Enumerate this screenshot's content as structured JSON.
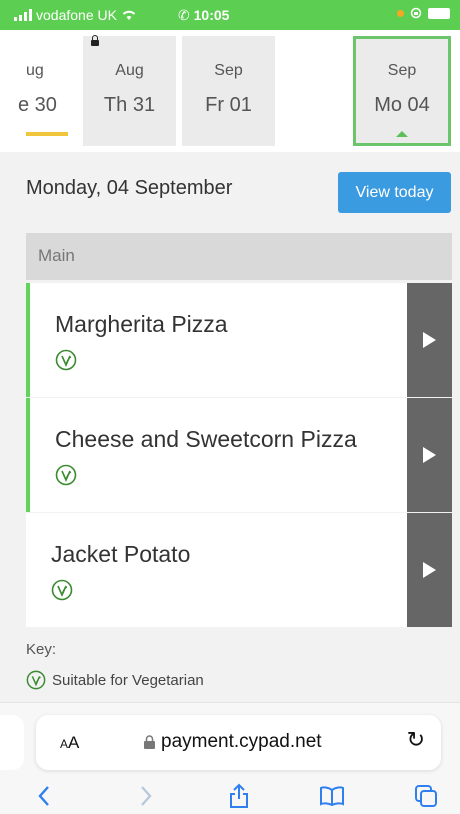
{
  "status_bar": {
    "carrier": "vodafone UK",
    "time": "10:05"
  },
  "date_strip": {
    "days": [
      {
        "month": "ug",
        "day": "e 30",
        "is_today": true
      },
      {
        "month": "Aug",
        "day": "Th 31",
        "locked": true
      },
      {
        "month": "Sep",
        "day": "Fr 01"
      },
      {
        "month": "Sep",
        "day": "Mo 04",
        "selected": true
      }
    ]
  },
  "page": {
    "date_heading": "Monday, 04 September",
    "view_today_label": "View today",
    "section_title": "Main"
  },
  "menu_items": [
    {
      "name": "Margherita Pizza",
      "vegetarian": true
    },
    {
      "name": "Cheese and Sweetcorn Pizza",
      "vegetarian": true
    },
    {
      "name": "Jacket Potato",
      "vegetarian": true
    }
  ],
  "key": {
    "label": "Key:",
    "vegetarian_label": "Suitable for Vegetarian"
  },
  "browser": {
    "text_size_label_small": "A",
    "text_size_label_large": "A",
    "url": "payment.cypad.net"
  },
  "colors": {
    "status_bar": "#5ccf52",
    "accent_blue": "#3b9be0",
    "veg_green": "#63d45a",
    "today_marker": "#f0c63c"
  },
  "icons": {
    "veg": "leaf-in-circle-icon",
    "arrow": "play-arrow-icon",
    "back": "chevron-left-icon",
    "forward": "chevron-right-icon",
    "share": "share-icon",
    "bookmarks": "book-icon",
    "tabs": "tabs-icon",
    "reload": "reload-icon",
    "lock": "lock-icon"
  }
}
